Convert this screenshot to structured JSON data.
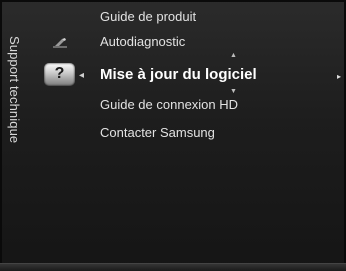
{
  "sidebar": {
    "title": "Support technique"
  },
  "icons": {
    "setup": "setup-icon",
    "support": "support-question-icon",
    "support_glyph": "?"
  },
  "menu": {
    "items": [
      {
        "label": "Guide de produit"
      },
      {
        "label": "Autodiagnostic"
      },
      {
        "label": "Mise à jour du logiciel",
        "selected": true
      },
      {
        "label": "Guide de connexion HD"
      },
      {
        "label": "Contacter Samsung"
      }
    ]
  },
  "arrows": {
    "left": "◂",
    "right": "▸",
    "up": "▲",
    "down": "▼"
  },
  "colors": {
    "background": "#1d1d1d",
    "text": "#e2e2e2",
    "selected_text": "#ffffff"
  }
}
